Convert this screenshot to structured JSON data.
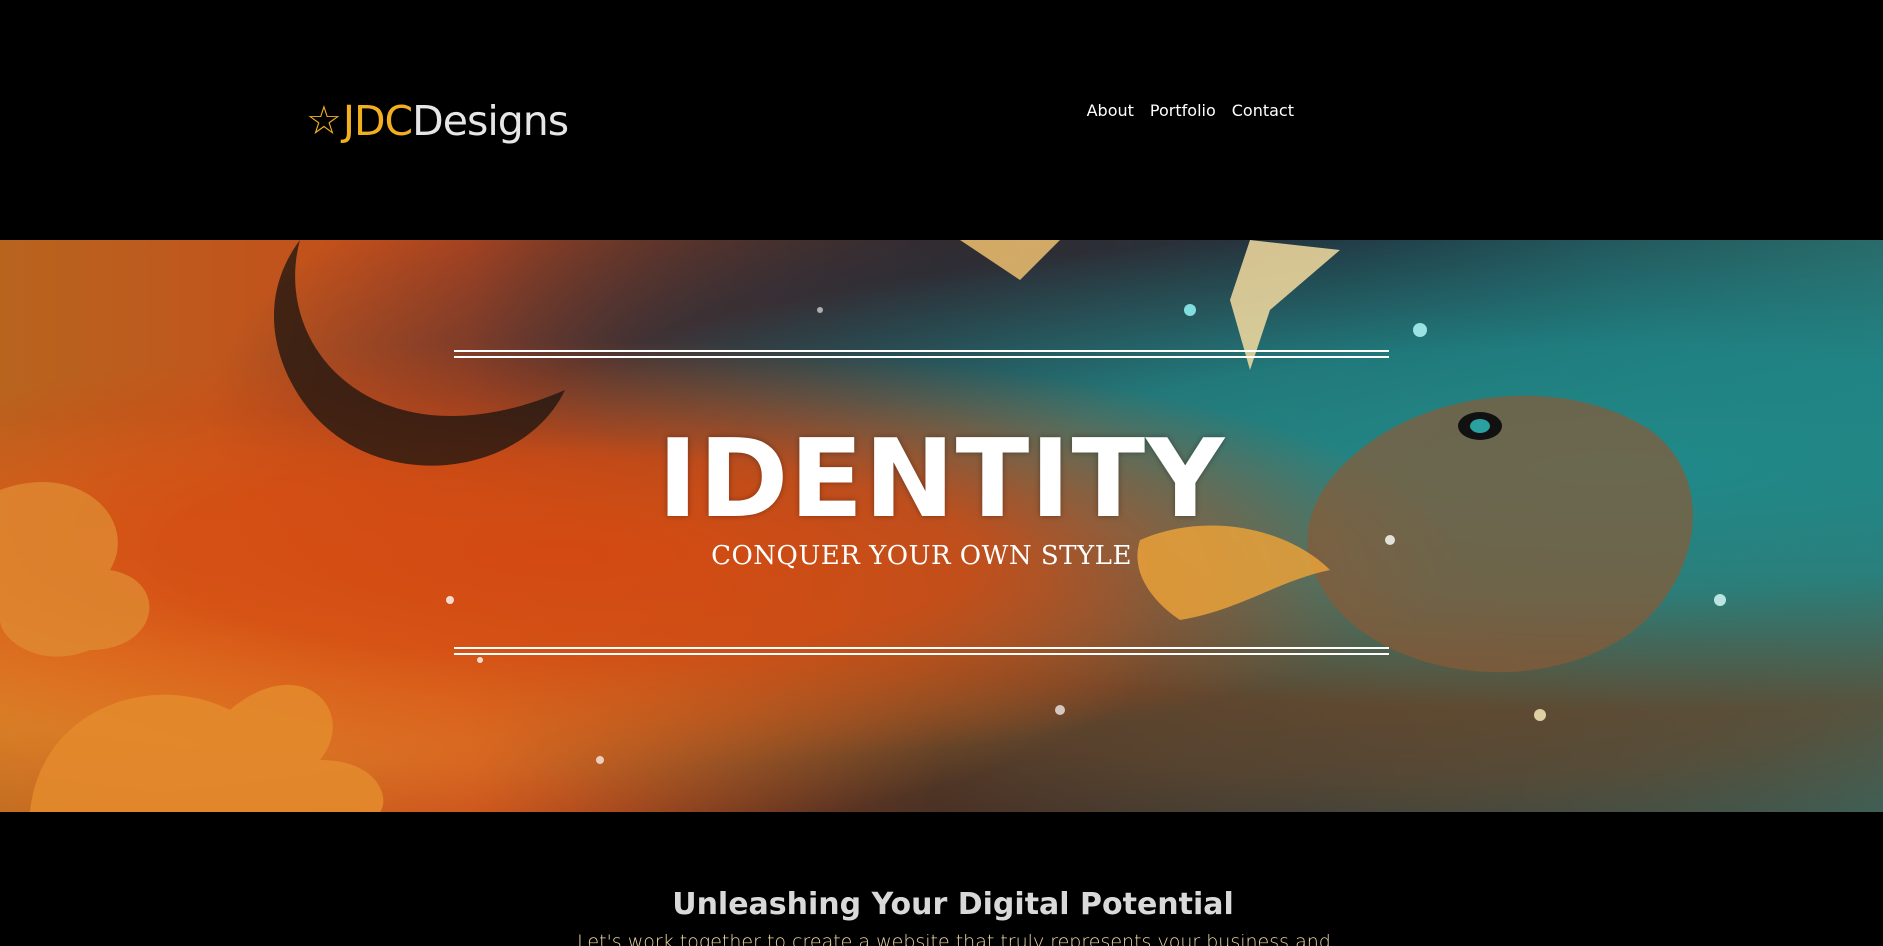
{
  "header": {
    "logo": {
      "star_icon": "star-icon",
      "accent_text": "JDC",
      "main_text": "Designs",
      "accent_color": "#f2b01e"
    },
    "nav": {
      "items": [
        {
          "label": "About"
        },
        {
          "label": "Portfolio"
        },
        {
          "label": "Contact"
        }
      ]
    }
  },
  "hero": {
    "title": "IDENTITY",
    "subtitle": "CONQUER YOUR OWN STYLE"
  },
  "intro": {
    "heading": "Unleashing Your Digital Potential",
    "text": "Let's work together to create a website that truly represents your business and takes it"
  }
}
